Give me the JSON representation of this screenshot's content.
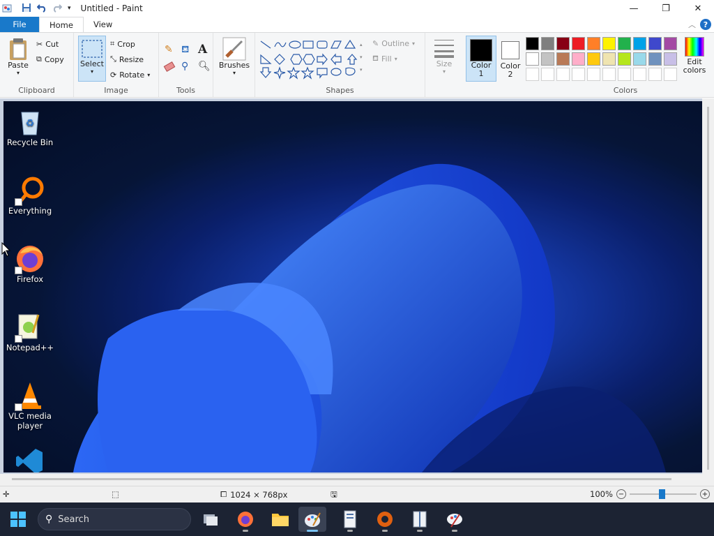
{
  "window": {
    "title": "Untitled - Paint",
    "minimize_icon": "minimize-icon",
    "maximize_icon": "restore-icon",
    "close_icon": "close-icon"
  },
  "tabs": {
    "file": "File",
    "home": "Home",
    "view": "View"
  },
  "ribbon": {
    "clipboard": {
      "label": "Clipboard",
      "paste": "Paste",
      "cut": "Cut",
      "copy": "Copy"
    },
    "image": {
      "label": "Image",
      "select": "Select",
      "crop": "Crop",
      "resize": "Resize",
      "rotate": "Rotate"
    },
    "tools": {
      "label": "Tools"
    },
    "brushes": {
      "label": "Brushes"
    },
    "shapes": {
      "label": "Shapes",
      "outline": "Outline",
      "fill": "Fill"
    },
    "size": {
      "label": "Size"
    },
    "color1": {
      "label": "Color 1",
      "value": "#000000"
    },
    "color2": {
      "label": "Color 2",
      "value": "#ffffff"
    },
    "colors": {
      "label": "Colors",
      "edit": "Edit colors",
      "row1": [
        "#000000",
        "#7f7f7f",
        "#880015",
        "#ed1c24",
        "#ff7f27",
        "#fff200",
        "#22b14c",
        "#00a2e8",
        "#3f48cc",
        "#a349a4"
      ],
      "row2": [
        "#ffffff",
        "#c3c3c3",
        "#b97a57",
        "#ffaec9",
        "#ffc90e",
        "#efe4b0",
        "#b5e61d",
        "#99d9ea",
        "#7092be",
        "#c8bfe7"
      ]
    }
  },
  "desktop_icons": [
    {
      "label": "Recycle Bin"
    },
    {
      "label": "Everything"
    },
    {
      "label": "Firefox"
    },
    {
      "label": "Notepad++"
    },
    {
      "label": "VLC media player"
    }
  ],
  "statusbar": {
    "dimensions": "1024 × 768px",
    "zoom": "100%",
    "zoom_level": 1.0
  },
  "taskbar": {
    "search_placeholder": "Search"
  }
}
